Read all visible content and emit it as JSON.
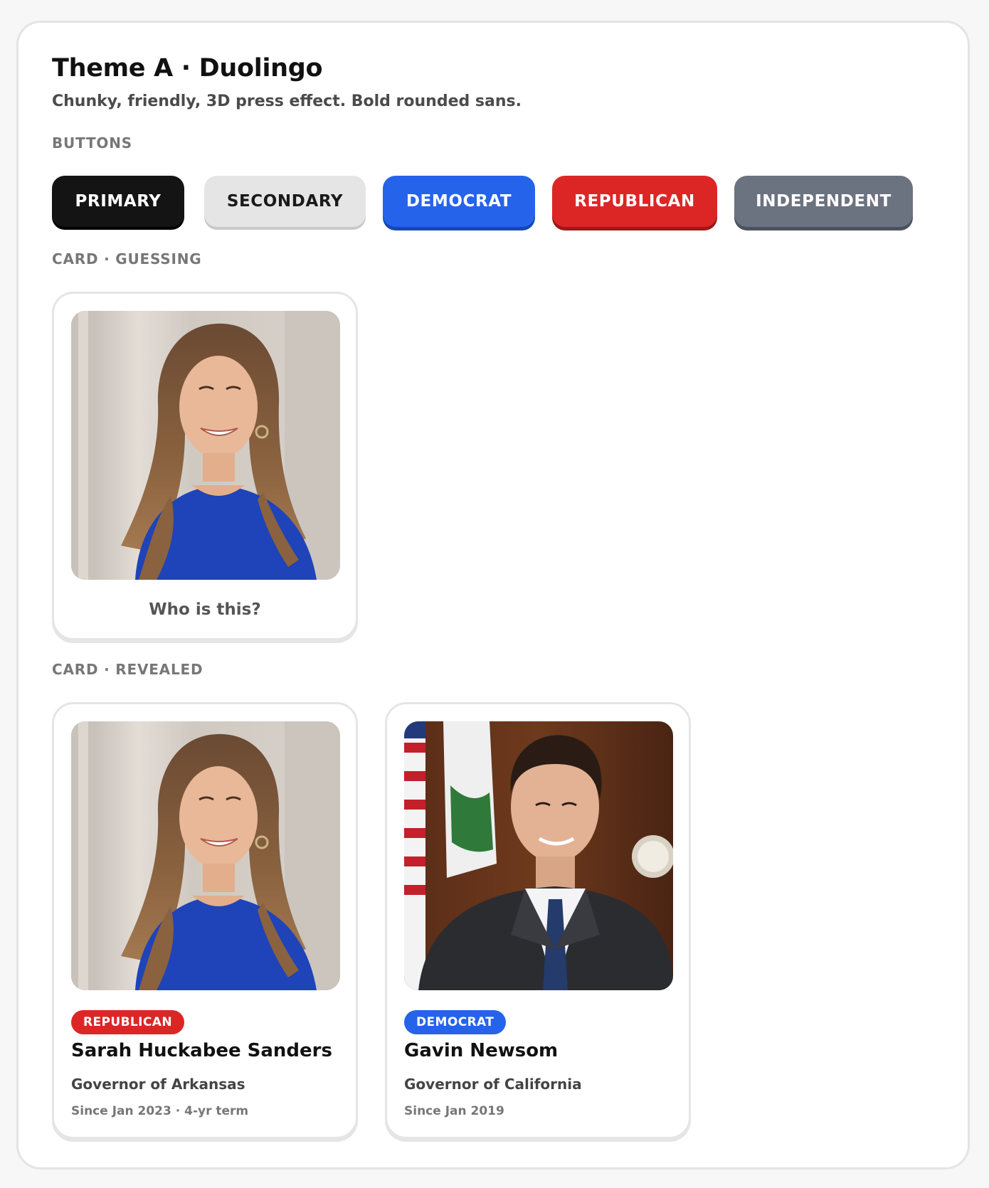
{
  "header": {
    "title": "Theme A · Duolingo",
    "subtitle": "Chunky, friendly, 3D press effect. Bold rounded sans."
  },
  "sections": {
    "buttons": "BUTTONS",
    "card_guessing": "CARD · GUESSING",
    "card_revealed": "CARD · REVEALED"
  },
  "buttons": {
    "primary": "PRIMARY",
    "secondary": "SECONDARY",
    "democrat": "DEMOCRAT",
    "republican": "REPUBLICAN",
    "independent": "INDEPENDENT"
  },
  "colors": {
    "primary": "#141414",
    "secondary": "#e5e5e5",
    "democrat": "#2563eb",
    "republican": "#dc2626",
    "independent": "#6b7280"
  },
  "guessing_card": {
    "prompt": "Who is this?",
    "photo": "portrait-woman"
  },
  "revealed_cards": [
    {
      "party": "REPUBLICAN",
      "name": "Sarah Huckabee Sanders",
      "office": "Governor of Arkansas",
      "since": "Since Jan 2023 · 4-yr term",
      "photo": "portrait-woman"
    },
    {
      "party": "DEMOCRAT",
      "name": "Gavin Newsom",
      "office": "Governor of California",
      "since": "Since Jan 2019",
      "photo": "portrait-man"
    }
  ]
}
